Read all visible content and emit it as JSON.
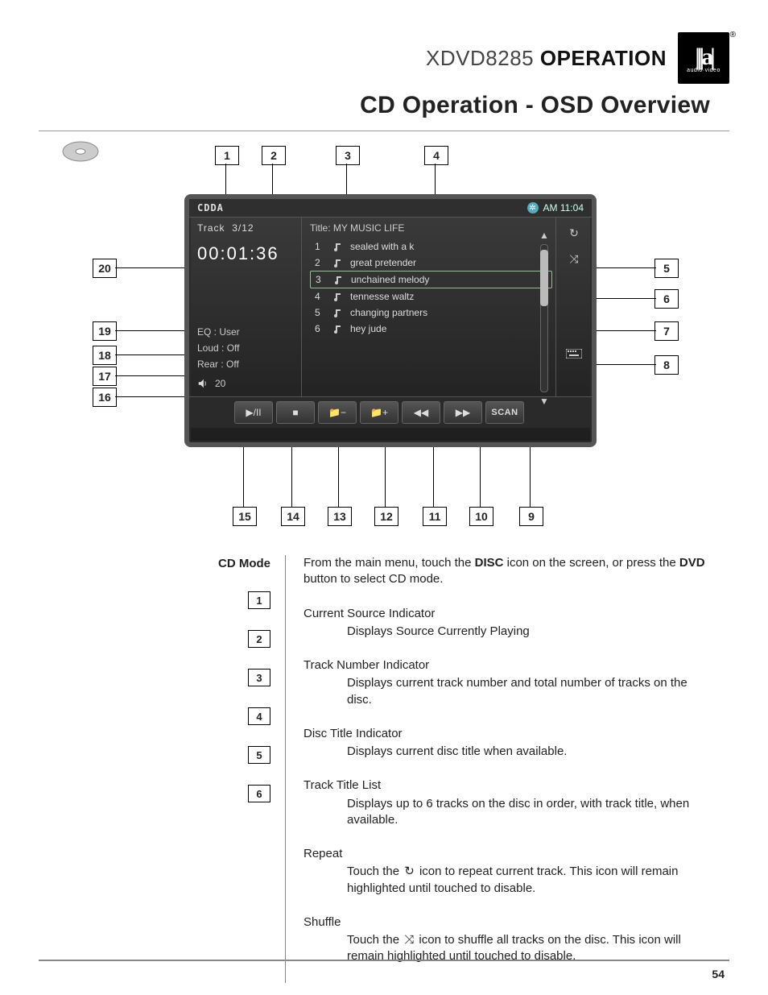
{
  "header": {
    "model": "XDVD8285",
    "operation": "OPERATION",
    "logo_sub": "audio·video"
  },
  "section_title": "CD Operation - OSD Overview",
  "page_number": "54",
  "callouts_top": [
    "1",
    "2",
    "3",
    "4"
  ],
  "callouts_right": [
    "5",
    "6",
    "7",
    "8"
  ],
  "callouts_left": [
    "20",
    "19",
    "18",
    "17",
    "16"
  ],
  "callouts_bottom": [
    "15",
    "14",
    "13",
    "12",
    "11",
    "10",
    "9"
  ],
  "osd": {
    "source": "CDDA",
    "clock": "AM 11:04",
    "track_label": "Track",
    "track_value": "3/12",
    "elapsed": "00:01:36",
    "eq": "EQ   : User",
    "loud": "Loud : Off",
    "rear": "Rear : Off",
    "volume": "20",
    "title_prefix": "Title: ",
    "title": "MY  MUSIC LIFE",
    "tracks": [
      {
        "n": "1",
        "name": "sealed with a k"
      },
      {
        "n": "2",
        "name": "great pretender"
      },
      {
        "n": "3",
        "name": "unchained melody",
        "sel": true
      },
      {
        "n": "4",
        "name": "tennesse waltz"
      },
      {
        "n": "5",
        "name": "changing partners"
      },
      {
        "n": "6",
        "name": "hey jude"
      }
    ],
    "bottom_buttons": [
      "play-pause",
      "stop",
      "folder-minus",
      "folder-plus",
      "rewind",
      "forward",
      "scan"
    ],
    "scan_label": "SCAN"
  },
  "legend": {
    "first_label": "CD Mode",
    "first_text_a": "From the main menu, touch the ",
    "first_bold_a": "DISC",
    "first_text_b": " icon on the screen, or press the ",
    "first_bold_b": "DVD",
    "first_text_c": " button to select CD mode.",
    "items": [
      {
        "n": "1",
        "t": "Current Source Indicator",
        "d": "Displays Source Currently Playing"
      },
      {
        "n": "2",
        "t": "Track Number Indicator",
        "d": "Displays current track number and total number of tracks on the disc."
      },
      {
        "n": "3",
        "t": "Disc Title Indicator",
        "d": "Displays current disc title when available."
      },
      {
        "n": "4",
        "t": "Track Title List",
        "d": "Displays up to 6 tracks on the disc in order, with track title, when available."
      },
      {
        "n": "5",
        "t": "Repeat",
        "d_pre": "Touch the ",
        "d_post": " icon to repeat current track. This icon will remain highlighted until touched to disable.",
        "icon": "repeat"
      },
      {
        "n": "6",
        "t": "Shuffle",
        "d_pre": "Touch the ",
        "d_post": " icon to shuffle all tracks on the disc. This icon will remain highlighted until touched to disable.",
        "icon": "shuffle"
      }
    ]
  }
}
